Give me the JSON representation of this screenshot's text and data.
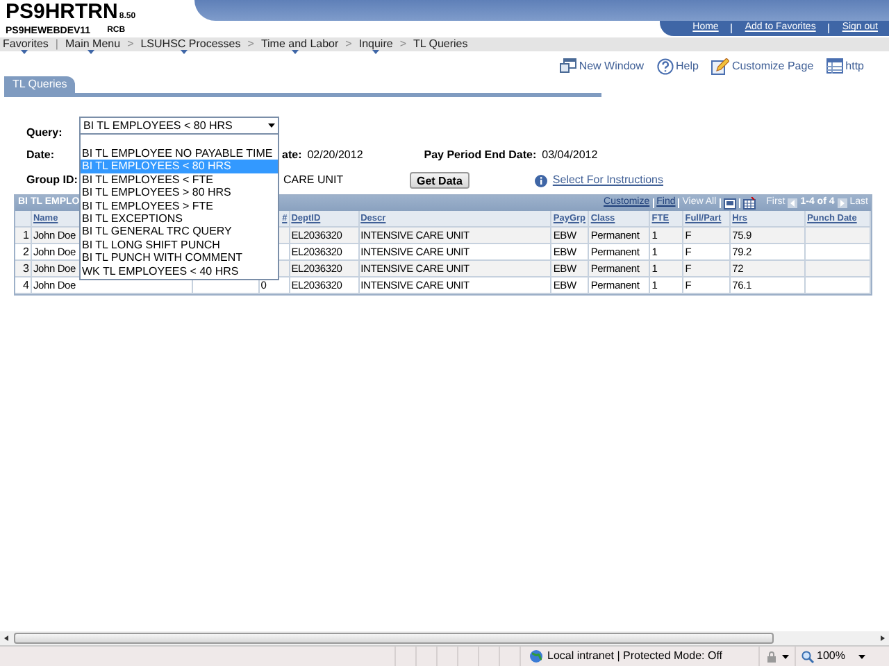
{
  "header": {
    "title": "PS9HRTRN",
    "version": "8.50",
    "server": "PS9HEWEBDEV11",
    "user": "RCB"
  },
  "top_links": [
    "Home",
    "Add to Favorites",
    "Sign out"
  ],
  "menu": [
    {
      "label": "Favorites",
      "dropdown": true,
      "sep": "|"
    },
    {
      "label": "Main Menu",
      "dropdown": true,
      "sep": ">"
    },
    {
      "label": "LSUHSC Processes",
      "dropdown": true,
      "sep": ">"
    },
    {
      "label": "Time and Labor",
      "dropdown": true,
      "sep": ">"
    },
    {
      "label": "Inquire",
      "dropdown": true,
      "sep": ">"
    },
    {
      "label": "TL Queries",
      "dropdown": false
    }
  ],
  "toolbar": [
    {
      "label": "New Window",
      "kind": "window"
    },
    {
      "label": "Help",
      "kind": "help"
    },
    {
      "label": "Customize Page",
      "kind": "customize"
    },
    {
      "label": "http",
      "kind": "link"
    }
  ],
  "tab": {
    "label": "TL Queries",
    "selected": true
  },
  "form": {
    "query_label": "Query:",
    "query_value": "BI TL EMPLOYEES < 80 HRS",
    "date_label": "Date:",
    "begin_date_label": "ate:",
    "begin_date": "02/20/2012",
    "end_date_label": "Pay Period End Date:",
    "end_date": "03/04/2012",
    "group_label": "Group ID:",
    "group_desc": "CARE UNIT",
    "button": "Get Data",
    "instructions_link": "Select For Instructions"
  },
  "dropdown": {
    "options": [
      {
        "label": "BI TL EMPLOYEE NO PAYABLE TIME",
        "selected": false
      },
      {
        "label": "BI TL EMPLOYEES < 80 HRS",
        "selected": true
      },
      {
        "label": "BI TL EMPLOYEES < FTE",
        "selected": false
      },
      {
        "label": "BI TL EMPLOYEES > 80 HRS",
        "selected": false
      },
      {
        "label": "BI TL EMPLOYEES > FTE",
        "selected": false
      },
      {
        "label": "BI TL EXCEPTIONS",
        "selected": false
      },
      {
        "label": "BI TL GENERAL TRC QUERY",
        "selected": false
      },
      {
        "label": "BI TL LONG SHIFT PUNCH",
        "selected": false
      },
      {
        "label": "BI TL PUNCH WITH COMMENT",
        "selected": false
      },
      {
        "label": "WK TL EMPLOYEES < 40 HRS",
        "selected": false
      }
    ]
  },
  "grid": {
    "title": "BI TL EMPLO",
    "nav": [
      {
        "label": "Customize",
        "disabled": false
      },
      {
        "label": "Find",
        "disabled": false
      },
      {
        "label": "View All",
        "disabled": true
      }
    ],
    "first": {
      "label": "First",
      "disabled": true
    },
    "range": "1-4 of 4",
    "last": {
      "label": "Last",
      "disabled": true
    },
    "columns": [
      {
        "label": "Name"
      },
      {},
      {
        "label": "#"
      },
      {
        "label": "DeptID"
      },
      {
        "label": "Descr"
      },
      {
        "label": "PayGrp"
      },
      {
        "label": "Class"
      },
      {
        "label": "FTE"
      },
      {
        "label": "Full/Part"
      },
      {
        "label": "Hrs"
      },
      {
        "label": "Punch Date"
      }
    ],
    "rows": [
      {
        "number": "1",
        "cells": [
          "John Doe",
          null,
          null,
          "EL2036320",
          "INTENSIVE CARE UNIT",
          "EBW",
          "Permanent",
          "1",
          "F",
          "75.9",
          null
        ]
      },
      {
        "number": "2",
        "cells": [
          "John Doe",
          null,
          null,
          "EL2036320",
          "INTENSIVE CARE UNIT",
          "EBW",
          "Permanent",
          "1",
          "F",
          "79.2",
          null
        ]
      },
      {
        "number": "3",
        "cells": [
          "John Doe",
          null,
          null,
          "EL2036320",
          "INTENSIVE CARE UNIT",
          "EBW",
          "Permanent",
          "1",
          "F",
          "72",
          null
        ]
      },
      {
        "number": "4",
        "cells": [
          "John Doe",
          null,
          "0",
          "EL2036320",
          "INTENSIVE CARE UNIT",
          "EBW",
          "Permanent",
          "1",
          "F",
          "76.1",
          null
        ]
      }
    ]
  },
  "status_bar": {
    "zone": "Local intranet | Protected Mode: Off",
    "zoom": "100%"
  }
}
